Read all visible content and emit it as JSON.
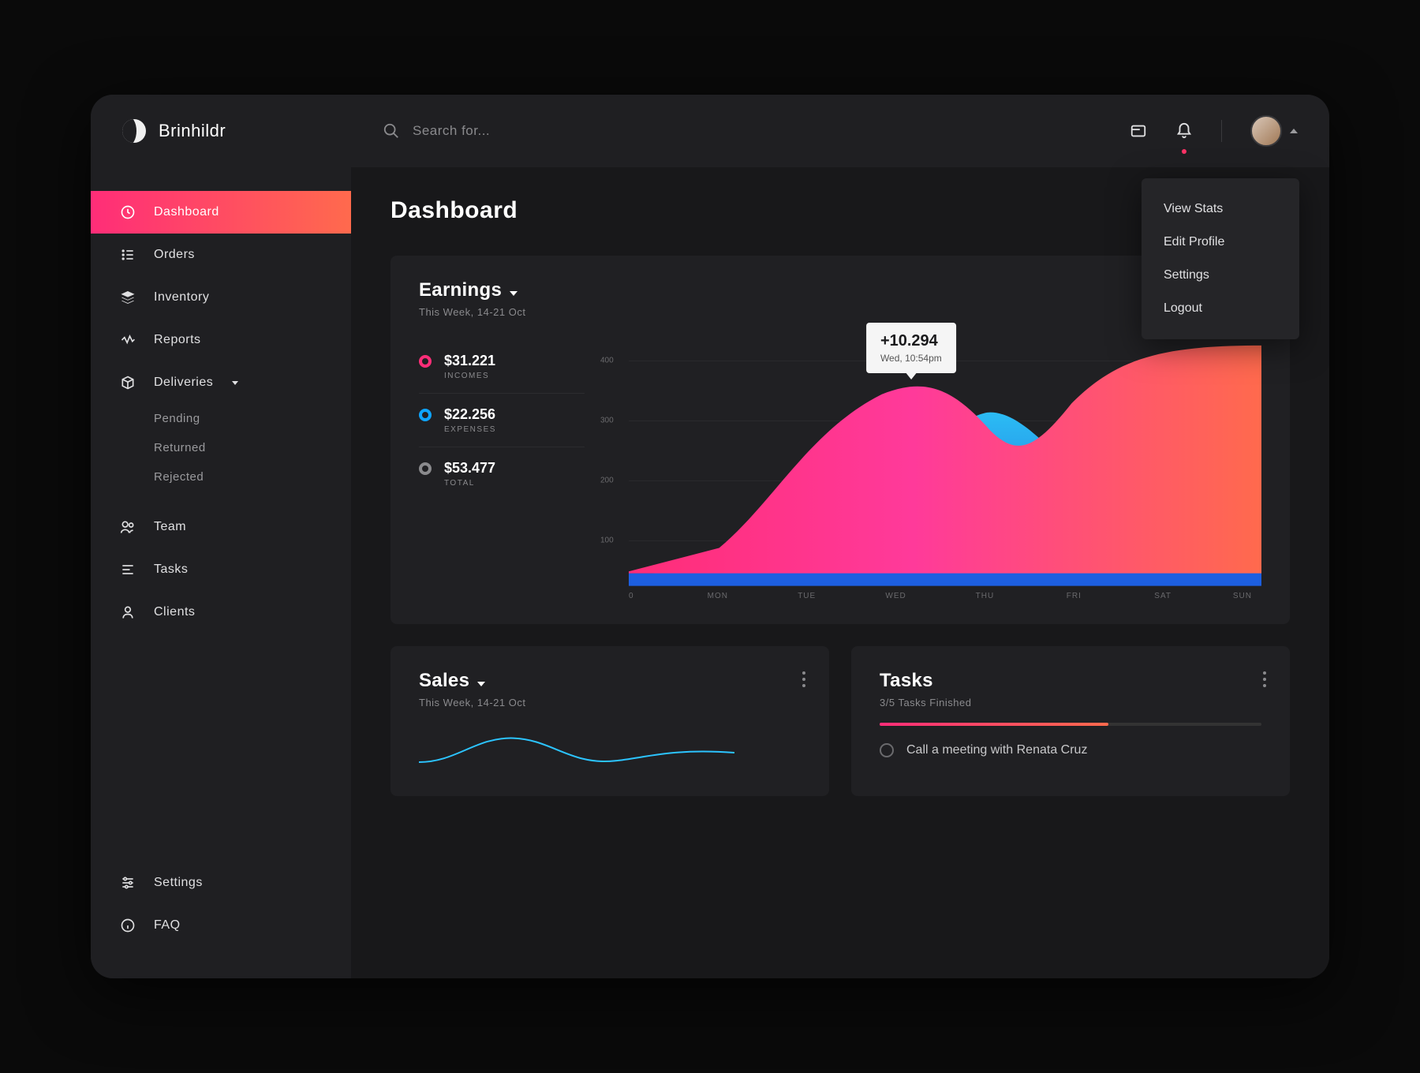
{
  "brand": "Brinhildr",
  "search": {
    "placeholder": "Search for..."
  },
  "sidebar": {
    "items": [
      {
        "label": "Dashboard"
      },
      {
        "label": "Orders"
      },
      {
        "label": "Inventory"
      },
      {
        "label": "Reports"
      },
      {
        "label": "Deliveries"
      }
    ],
    "deliveries_sub": [
      {
        "label": "Pending"
      },
      {
        "label": "Returned"
      },
      {
        "label": "Rejected"
      }
    ],
    "items2": [
      {
        "label": "Team"
      },
      {
        "label": "Tasks"
      },
      {
        "label": "Clients"
      }
    ],
    "footer": [
      {
        "label": "Settings"
      },
      {
        "label": "FAQ"
      }
    ]
  },
  "dropdown": {
    "items": [
      {
        "label": "View Stats"
      },
      {
        "label": "Edit Profile"
      },
      {
        "label": "Settings"
      },
      {
        "label": "Logout"
      }
    ]
  },
  "page": {
    "title": "Dashboard"
  },
  "earnings": {
    "title": "Earnings",
    "subtitle": "This Week, 14-21 Oct",
    "metrics": {
      "incomes": {
        "value": "$31.221",
        "label": "INCOMES"
      },
      "expenses": {
        "value": "$22.256",
        "label": "EXPENSES"
      },
      "total": {
        "value": "$53.477",
        "label": "TOTAL"
      }
    },
    "tooltip": {
      "value": "+10.294",
      "sub": "Wed, 10:54pm"
    }
  },
  "sales": {
    "title": "Sales",
    "subtitle": "This Week, 14-21 Oct"
  },
  "tasks": {
    "title": "Tasks",
    "subtitle": "3/5 Tasks Finished",
    "first_task": "Call a meeting with Renata Cruz"
  },
  "chart_data": {
    "type": "area",
    "title": "Earnings",
    "xlabel": "",
    "ylabel": "",
    "ylim": [
      0,
      400
    ],
    "y_ticks": [
      100,
      200,
      300,
      400
    ],
    "categories": [
      "0",
      "MON",
      "TUE",
      "WED",
      "THU",
      "FRI",
      "SAT",
      "SUN"
    ],
    "series": [
      {
        "name": "Incomes",
        "color": "#ff3a7a",
        "values": [
          30,
          80,
          260,
          310,
          260,
          340,
          400,
          400
        ]
      },
      {
        "name": "Expenses",
        "color": "#0ea5ff",
        "values": [
          20,
          40,
          80,
          130,
          280,
          200,
          120,
          60
        ]
      }
    ],
    "tooltip_point": {
      "x": "WED",
      "value": 10.294,
      "time": "10:54pm"
    }
  }
}
